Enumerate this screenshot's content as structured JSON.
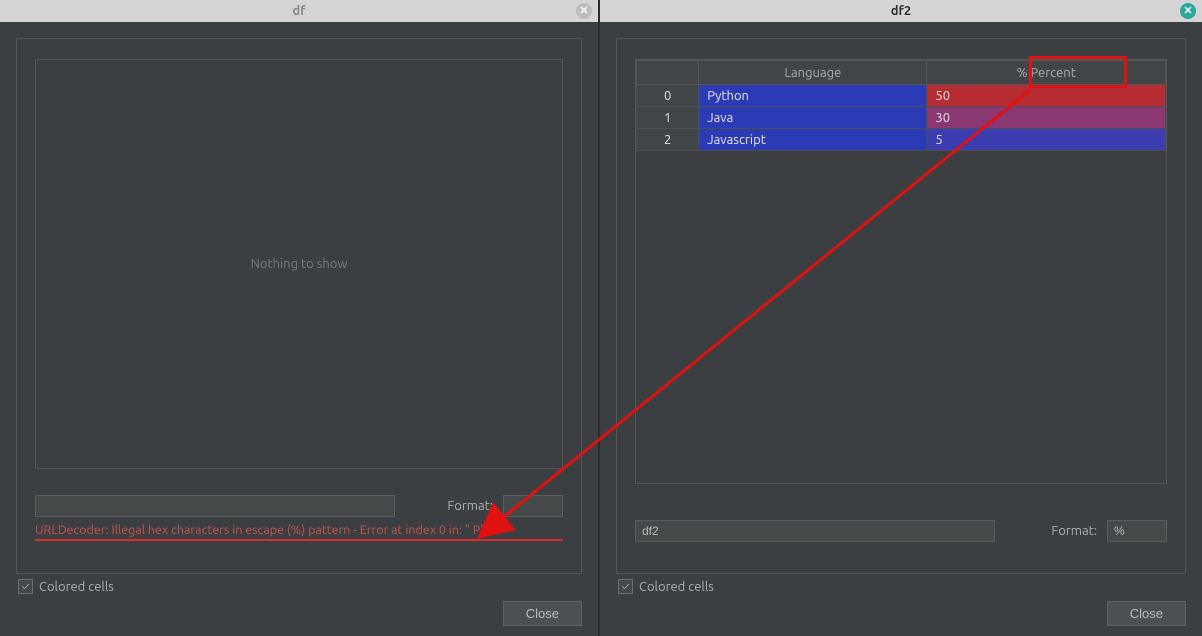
{
  "left": {
    "title": "df",
    "placeholder": "Nothing to show",
    "name_value": "",
    "format_label": "Format:",
    "format_value": "",
    "error": "URLDecoder: Illegal hex characters in escape (%) pattern - Error at index 0 in: \" P\"",
    "colored_label": "Colored cells",
    "close_label": "Close"
  },
  "right": {
    "title": "df2",
    "columns": {
      "index": "",
      "lang": "Language",
      "pct": "% Percent"
    },
    "rows": [
      {
        "idx": "0",
        "lang": "Python",
        "pct": "50",
        "color": "#b52c32"
      },
      {
        "idx": "1",
        "lang": "Java",
        "pct": "30",
        "color": "#8a3772"
      },
      {
        "idx": "2",
        "lang": "Javascript",
        "pct": "5",
        "color": "#3a3cb0"
      }
    ],
    "name_value": "df2",
    "format_label": "Format:",
    "format_value": "%",
    "colored_label": "Colored cells",
    "close_label": "Close"
  }
}
